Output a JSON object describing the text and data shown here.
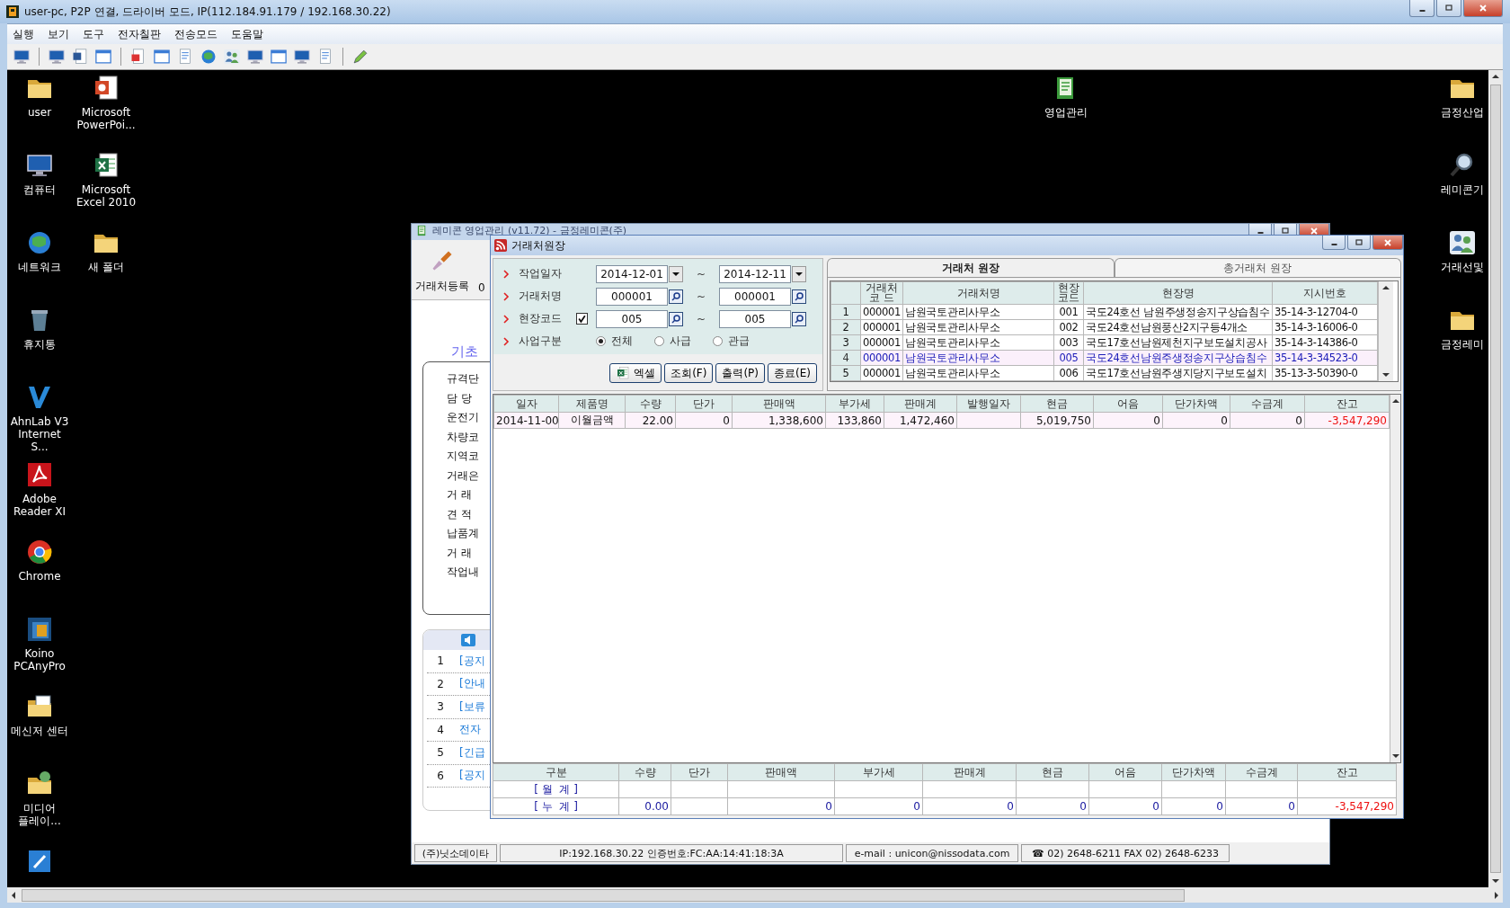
{
  "remote_window": {
    "title": "user-pc, P2P 연결, 드라이버 모드, IP(112.184.91.179 / 192.168.30.22)"
  },
  "menu": [
    "실행",
    "보기",
    "도구",
    "전자칠판",
    "전송모드",
    "도움말"
  ],
  "desktop": {
    "icons": [
      {
        "label": "user",
        "kind": "folder"
      },
      {
        "label": "컴퓨터",
        "kind": "computer"
      },
      {
        "label": "네트워크",
        "kind": "network"
      },
      {
        "label": "휴지통",
        "kind": "trash"
      },
      {
        "label": "AhnLab V3 Internet S...",
        "kind": "vshape"
      },
      {
        "label": "Adobe Reader XI",
        "kind": "redapp"
      },
      {
        "label": "Chrome",
        "kind": "round"
      },
      {
        "label": "Koino PCAnyPro",
        "kind": "squares"
      },
      {
        "label": "메신저 센터",
        "kind": "messenger"
      },
      {
        "label": "미디어 플레이...",
        "kind": "media"
      },
      {
        "kind": "pen"
      },
      {
        "label": "Microsoft PowerPoi...",
        "kind": "slides"
      },
      {
        "label": "Microsoft Excel 2010",
        "kind": "sheet"
      },
      {
        "label": "새 폴더",
        "kind": "folder"
      }
    ],
    "center_icons": [
      {
        "label": "영업관리",
        "kind": "book"
      }
    ],
    "edge_icons": [
      {
        "label": "금정산업",
        "kind": "folder"
      },
      {
        "label": "레미콘기",
        "kind": "magnifier"
      },
      {
        "label": "거래선및",
        "kind": "people"
      },
      {
        "label": "금정레미",
        "kind": "folder"
      }
    ]
  },
  "back_window": {
    "title": "레미콘 영업관리 (v11.72) - 금정레미콘(주)",
    "toolbar": [
      "거래처등록",
      "0"
    ],
    "section_title": "기초",
    "menu_items": [
      "규격단",
      "담 당",
      "운전기",
      "차량코",
      "지역코",
      "거래은",
      "거 래",
      "견 적",
      "납품계",
      "거 래",
      "작업내"
    ],
    "notices": [
      {
        "number": "1",
        "text": "[공지"
      },
      {
        "number": "2",
        "text": "[안내"
      },
      {
        "number": "3",
        "text": "[보류"
      },
      {
        "number": "4",
        "text": "전자"
      },
      {
        "number": "5",
        "text": "[긴급"
      },
      {
        "number": "6",
        "text": "[공지"
      }
    ],
    "status_bar": [
      "(주)닛소데이타",
      "IP:192.168.30.22  인증번호:FC:AA:14:41:18:3A",
      "e-mail : unicon@nissodata.com",
      "☎ 02) 2648-6211  FAX  02) 2648-6233"
    ]
  },
  "dialog": {
    "title": "거래처원장",
    "filters": [
      {
        "kind": "date",
        "label": "작업일자",
        "from": "2014-12-01",
        "separator": "~",
        "to": "2014-12-11"
      },
      {
        "kind": "lookup",
        "label": "거래처명",
        "from": "000001",
        "separator": "~",
        "to": "000001"
      },
      {
        "kind": "lookup",
        "label": "현장코드",
        "checked": true,
        "from": "005",
        "separator": "~",
        "to": "005"
      },
      {
        "kind": "radio",
        "label": "사업구분",
        "options": [
          {
            "label": "전체",
            "selected": true
          },
          {
            "label": "사급",
            "selected": false
          },
          {
            "label": "관급",
            "selected": false
          }
        ]
      }
    ],
    "buttons": [
      {
        "label": "엑셀",
        "kind": "excel"
      },
      {
        "label": "조회(F)",
        "kind": "plain"
      },
      {
        "label": "출력(P)",
        "kind": "plain"
      },
      {
        "label": "종료(E)",
        "kind": "plain"
      }
    ],
    "tabs": [
      {
        "label": "거래처 원장",
        "selected": true
      },
      {
        "label": "총거래처 원장",
        "selected": false
      }
    ],
    "client_table": {
      "columns": [
        "거래처\n코 드",
        "거래처명",
        "현장\n코드",
        "현장명",
        "지시번호"
      ],
      "rows": [
        {
          "number": "1",
          "selected": false,
          "cells": [
            "000001",
            "남원국토관리사무소",
            "001",
            "국도24호선 남원주생정송지구상습침수",
            "35-14-3-12704-0"
          ]
        },
        {
          "number": "2",
          "selected": false,
          "cells": [
            "000001",
            "남원국토관리사무소",
            "002",
            "국도24호선남원풍산2지구등4개소",
            "35-14-3-16006-0"
          ]
        },
        {
          "number": "3",
          "selected": false,
          "cells": [
            "000001",
            "남원국토관리사무소",
            "003",
            "국도17호선남원제천지구보도설치공사",
            "35-14-3-14386-0"
          ]
        },
        {
          "number": "4",
          "selected": true,
          "cells": [
            "000001",
            "남원국토관리사무소",
            "005",
            "국도24호선남원주생정송지구상습침수",
            "35-14-3-34523-0"
          ]
        },
        {
          "number": "5",
          "selected": false,
          "cells": [
            "000001",
            "남원국토관리사무소",
            "006",
            "국도17호선남원주생지당지구보도설치",
            "35-13-3-50390-0"
          ]
        }
      ]
    },
    "ledger": {
      "columns": [
        "일자",
        "제품명",
        "수량",
        "단가",
        "판매액",
        "부가세",
        "판매계",
        "발행일자",
        "현금",
        "어음",
        "단가차액",
        "수금계",
        "잔고"
      ],
      "rows": [
        [
          "2014-11-00",
          "이월금액",
          "22.00",
          "0",
          "1,338,600",
          "133,860",
          "1,472,460",
          null,
          "5,019,750",
          "0",
          "0",
          "0",
          {
            "text": "-3,547,290",
            "negative": true
          }
        ]
      ]
    },
    "summary": {
      "columns": [
        "구분",
        "수량",
        "단가",
        "판매액",
        "부가세",
        "판매계",
        "현금",
        "어음",
        "단가차액",
        "수금계",
        "잔고"
      ],
      "rows": [
        [
          "[ 월  계 ]",
          null,
          null,
          null,
          null,
          null,
          null,
          null,
          null,
          null,
          null
        ],
        [
          "[ 누  계 ]",
          "0.00",
          null,
          "0",
          "0",
          "0",
          "0",
          "0",
          "0",
          "0",
          {
            "text": "-3,547,290",
            "negative": true
          }
        ]
      ]
    }
  }
}
